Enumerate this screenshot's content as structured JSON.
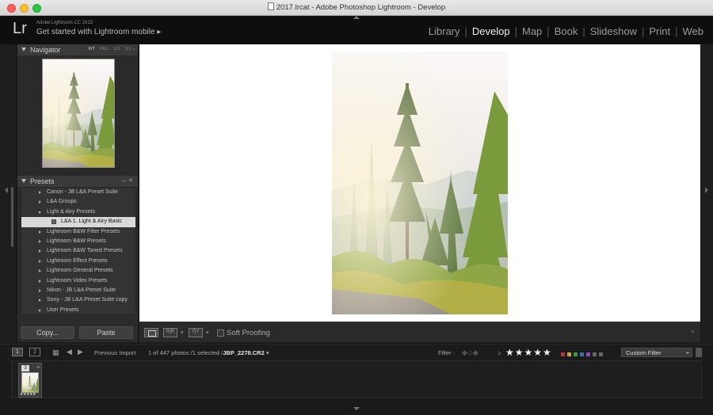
{
  "window": {
    "title": "2017.lrcat - Adobe Photoshop Lightroom - Develop"
  },
  "identity": {
    "logo": "Lr",
    "product": "Adobe Lightroom CC 2015",
    "mobile": "Get started with Lightroom mobile ▸"
  },
  "modules": [
    {
      "label": "Library",
      "active": false
    },
    {
      "label": "Develop",
      "active": true
    },
    {
      "label": "Map",
      "active": false
    },
    {
      "label": "Book",
      "active": false
    },
    {
      "label": "Slideshow",
      "active": false
    },
    {
      "label": "Print",
      "active": false
    },
    {
      "label": "Web",
      "active": false
    }
  ],
  "navigator": {
    "title": "Navigator",
    "zoom": {
      "fit": "FIT",
      "fill": "FILL",
      "one": "1:1",
      "three": "3:1 ÷"
    }
  },
  "presets": {
    "title": "Presets",
    "controls": "–  +",
    "items": [
      {
        "label": "Canon - JB L&A Preset Suite",
        "open": false,
        "child": false,
        "selected": false
      },
      {
        "label": "L&A Groups",
        "open": false,
        "child": false,
        "selected": false
      },
      {
        "label": "Light & Airy Presets",
        "open": true,
        "child": false,
        "selected": false
      },
      {
        "label": "L&A 1. Light & Airy Basic",
        "open": false,
        "child": true,
        "selected": true
      },
      {
        "label": "Lightroom B&W Filter Presets",
        "open": false,
        "child": false,
        "selected": false
      },
      {
        "label": "Lightroom B&W Presets",
        "open": false,
        "child": false,
        "selected": false
      },
      {
        "label": "Lightroom B&W Toned Presets",
        "open": false,
        "child": false,
        "selected": false
      },
      {
        "label": "Lightroom Effect Presets",
        "open": false,
        "child": false,
        "selected": false
      },
      {
        "label": "Lightroom General Presets",
        "open": false,
        "child": false,
        "selected": false
      },
      {
        "label": "Lightroom Video Presets",
        "open": false,
        "child": false,
        "selected": false
      },
      {
        "label": "Nikon - JB L&A Preset Suite",
        "open": false,
        "child": false,
        "selected": false
      },
      {
        "label": "Sony - JB L&A Preset Suite copy",
        "open": false,
        "child": false,
        "selected": false
      },
      {
        "label": "User Presets",
        "open": true,
        "child": false,
        "selected": false
      }
    ]
  },
  "buttons": {
    "copy": "Copy...",
    "paste": "Paste"
  },
  "toolbar": {
    "soft_proofing": "Soft Proofing",
    "view2": "R|R",
    "view3": "Y|Y",
    "dropdown": "▾"
  },
  "filmbar": {
    "page1": "1",
    "page2": "2",
    "source": "Previous Import",
    "count_prefix": "1 of 447 photos /1 selected /",
    "filename": "JBP_2278.CR2",
    "dropdown": "▾",
    "filter_label": "Filter :",
    "rating_op": "≥",
    "stars": "★★★★★",
    "custom_filter": "Custom Filter",
    "custom_arrow": "÷",
    "label_colors": [
      "#b03a3a",
      "#c9a23a",
      "#3f9a3f",
      "#3a6fb0",
      "#8a4fb0",
      "#666666",
      "#666666"
    ]
  },
  "filmstrip": {
    "thumb_number": "3",
    "badge": "▪▪",
    "thumb_stars": "★★★★★"
  },
  "colors": {
    "accent_active": "#f0f0f0",
    "panel_bg": "#2b2b2b",
    "selected_row": "#d9d9d9"
  }
}
